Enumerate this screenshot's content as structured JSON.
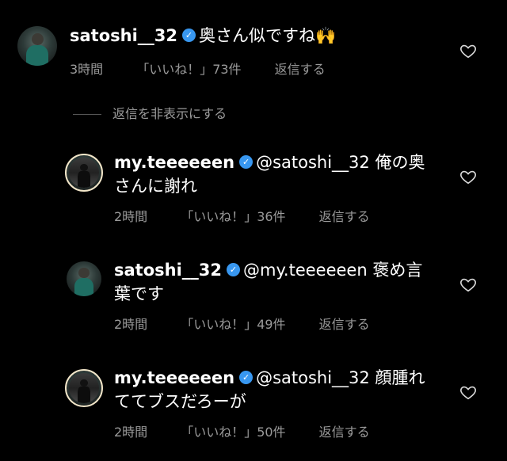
{
  "comments": [
    {
      "username": "satoshi__32",
      "text": "奥さん似ですね🙌",
      "time": "3時間",
      "likes": "「いいね！」73件",
      "reply": "返信する"
    }
  ],
  "hide_replies_label": "返信を非表示にする",
  "replies": [
    {
      "username": "my.teeeeeen",
      "text_line1": "@satoshi__32 俺の奥",
      "text_line2": "さんに謝れ",
      "time": "2時間",
      "likes": "「いいね！」36件",
      "reply": "返信する"
    },
    {
      "username": "satoshi__32",
      "text_line1": "@my.teeeeeen 褒め言",
      "text_line2": "葉です",
      "time": "2時間",
      "likes": "「いいね！」49件",
      "reply": "返信する"
    },
    {
      "username": "my.teeeeeen",
      "text_line1": "@satoshi__32 顔腫れ",
      "text_line2": "ててブスだろーが",
      "time": "2時間",
      "likes": "「いいね！」50件",
      "reply": "返信する"
    }
  ],
  "icons": {
    "verified": "verified-badge-icon",
    "like": "heart-outline-icon"
  },
  "colors": {
    "background": "#000000",
    "verified": "#3897f0",
    "meta_text": "#9a9a9a"
  }
}
